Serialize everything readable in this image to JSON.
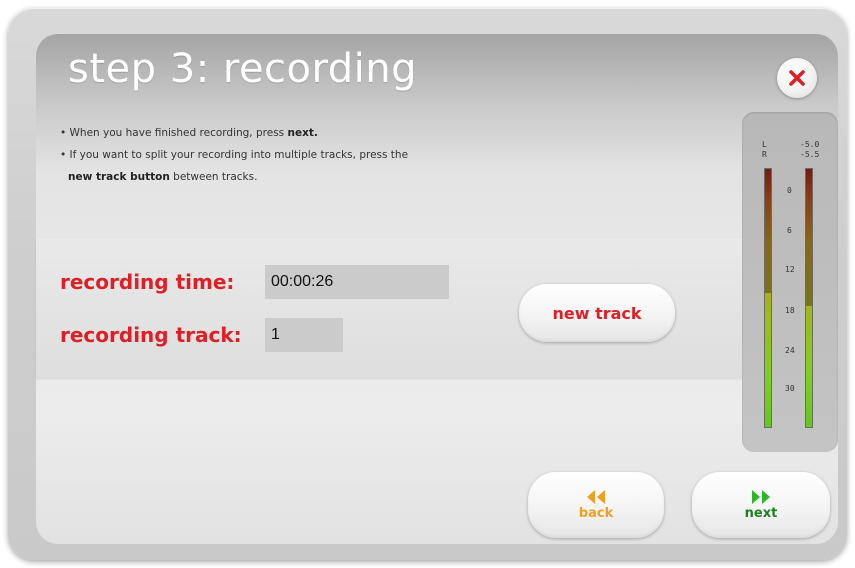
{
  "window": {
    "title": "step 3: recording"
  },
  "instructions": {
    "line1_prefix": "• When you have finished recording, press ",
    "line1_bold": "next.",
    "line2": "• If you want to split your recording into multiple tracks, press the",
    "line3_bold": "new track button",
    "line3_suffix": " between tracks."
  },
  "recording": {
    "time_label": "recording time:",
    "time_value": "00:00:26",
    "track_label": "recording track:",
    "track_value": "1"
  },
  "buttons": {
    "new_track": "new track",
    "back": "back",
    "next": "next"
  },
  "meter": {
    "channel_left": "L",
    "channel_right": "R",
    "peak_left": "-5.0",
    "peak_right": "-5.5",
    "scale": [
      "0",
      "6",
      "12",
      "18",
      "24",
      "30"
    ],
    "level_left_fraction": 0.52,
    "level_right_fraction": 0.47
  },
  "colors": {
    "accent_red": "#dd1f26",
    "back_orange": "#f0a020",
    "next_green": "#2db52d"
  },
  "icons": {
    "close": "close-icon",
    "back": "rewind-icon",
    "next": "fast-forward-icon"
  }
}
